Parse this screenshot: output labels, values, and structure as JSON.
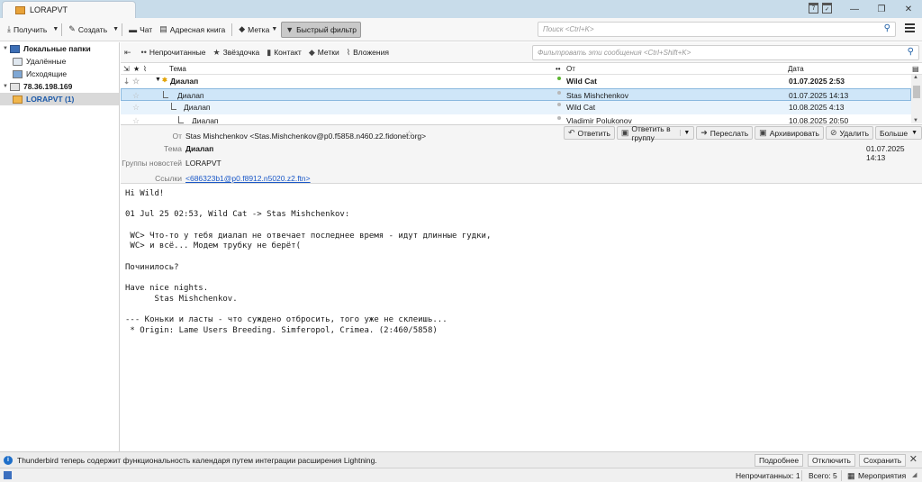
{
  "window": {
    "tab_title": "LORAPVT",
    "controls": [
      "—",
      "❐",
      "✕"
    ]
  },
  "toolbar": {
    "get_label": "Получить",
    "create_label": "Создать",
    "chat_label": "Чат",
    "address_book_label": "Адресная книга",
    "tag_label": "Метка",
    "quick_filter_label": "Быстрый фильтр",
    "search_placeholder": "Поиск <Ctrl+K>"
  },
  "folders": [
    {
      "label": "Локальные папки",
      "bold": true
    },
    {
      "label": "Удалённые"
    },
    {
      "label": "Исходящие"
    },
    {
      "label": "78.36.198.169",
      "bold": true
    },
    {
      "label": "LORAPVT (1)",
      "selected": true
    }
  ],
  "quick_filter": {
    "unread": "Непрочитанные",
    "starred": "Звёздочка",
    "contact": "Контакт",
    "tags": "Метки",
    "attachments": "Вложения",
    "filter_placeholder": "Фильтровать эти сообщения <Ctrl+Shift+K>"
  },
  "columns": {
    "subject": "Тема",
    "from": "От",
    "date": "Дата"
  },
  "messages": [
    {
      "subject": "Диалап",
      "from": "Wild Cat",
      "date": "01.07.2025 2:53"
    },
    {
      "subject": "Диалап",
      "from": "Stas Mishchenkov",
      "date": "01.07.2025 14:13"
    },
    {
      "subject": "Диалап",
      "from": "Wild Cat",
      "date": "10.08.2025 4:13"
    },
    {
      "subject": "Диалап",
      "from": "Vladimir Polukonov",
      "date": "10.08.2025 20:50"
    }
  ],
  "header": {
    "from_label": "От",
    "from_value": "Stas Mishchenkov <Stas.Mishchenkov@p0.f5858.n460.z2.fidonet.org>",
    "subject_label": "Тема",
    "subject_value": "Диалап",
    "newsgroups_label": "Группы новостей",
    "newsgroups_value": "LORAPVT",
    "references_label": "Ссылки",
    "references_value": "<686323b1@p0.f8912.n5020.z2.ftn>",
    "date": "01.07.2025 14:13",
    "buttons": {
      "reply": "Ответить",
      "reply_group": "Ответить в группу",
      "forward": "Переслать",
      "archive": "Архивировать",
      "delete": "Удалить",
      "more": "Больше"
    }
  },
  "body_lines": [
    "Hi Wild!",
    "",
    "01 Jul 25 02:53, Wild Cat -> Stas Mishchenkov:",
    "",
    " WC> Что-то у тебя диалап не отвечает последнее время - идут длинные гудки,",
    " WC> и всё... Модем трубку не берёт(",
    "",
    "Починилось?",
    "",
    "Have nice nights.",
    "      Stas Mishchenkov.",
    "",
    "--- Коньки и ласты - что суждено отбросить, того уже не склеишь...",
    " * Origin: Lame Users Breeding. Simferopol, Crimea. (2:460/5858)"
  ],
  "notification": {
    "text": "Thunderbird теперь содержит функциональность календаря путем интеграции расширения Lightning.",
    "details": "Подробнее",
    "disable": "Отключить",
    "keep": "Сохранить"
  },
  "status": {
    "unread": "Непрочитанных: 1",
    "total": "Всего: 5",
    "events": "Мероприятия"
  }
}
